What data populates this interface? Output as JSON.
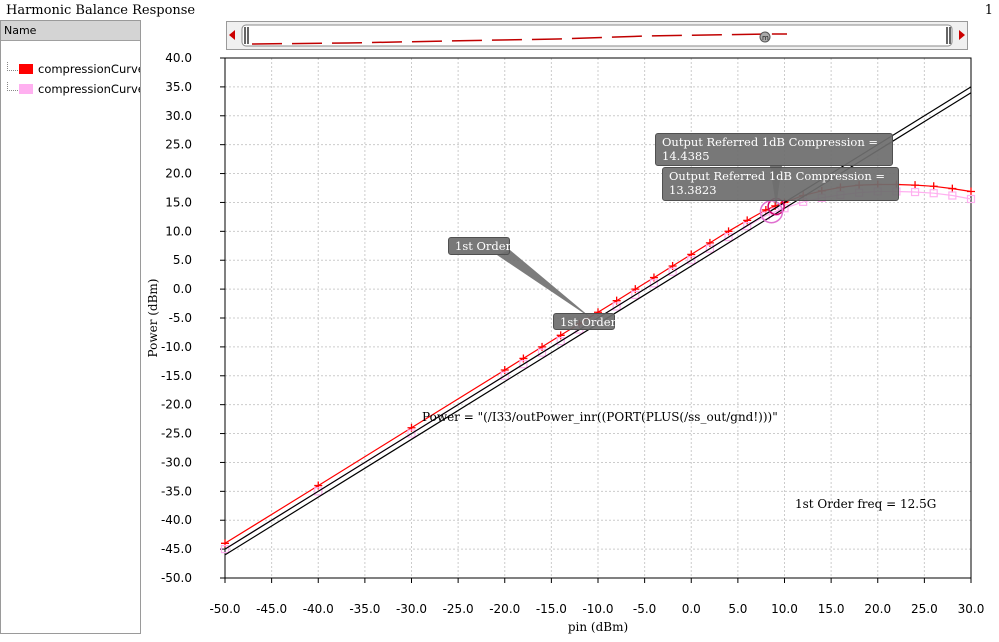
{
  "window": {
    "title": "Harmonic Balance Response",
    "number": "1"
  },
  "legend": {
    "header": "Name",
    "items": [
      {
        "label": "compressionCurve",
        "color": "#ff0000"
      },
      {
        "label": "compressionCurve",
        "color": "#ffb0f0"
      }
    ]
  },
  "colors": {
    "grid": "#cccccc",
    "line_black": "#000000",
    "annotation_bg": "#6e6e6e"
  },
  "annotations": {
    "compression1": "Output Referred 1dB Compression = \n14.4385",
    "compression2": "Output Referred 1dB Compression = \n13.3823",
    "order1_top": "1st Order",
    "order1_bottom": "1st Order",
    "expr1": "Power = \"(/I33/outPower_inr((PORT(PLUS(/ss_out/gnd!)))\"",
    "freq": "1st Order freq = 12.5G"
  },
  "chart_data": {
    "type": "line",
    "xlabel": "pin (dBm)",
    "ylabel": "Power (dBm)",
    "xlim": [
      -50,
      30
    ],
    "ylim": [
      -50,
      40
    ],
    "xticks": [
      "-50.0",
      "-45.0",
      "-40.0",
      "-35.0",
      "-30.0",
      "-25.0",
      "-20.0",
      "-15.0",
      "-10.0",
      "-5.0",
      "0.0",
      "5.0",
      "10.0",
      "15.0",
      "20.0",
      "25.0",
      "30.0"
    ],
    "yticks": [
      "40.0",
      "35.0",
      "30.0",
      "25.0",
      "20.0",
      "15.0",
      "10.0",
      "5.0",
      "0.0",
      "-5.0",
      "-10.0",
      "-15.0",
      "-20.0",
      "-25.0",
      "-30.0",
      "-35.0",
      "-40.0",
      "-45.0",
      "-50.0"
    ],
    "grid": true,
    "series": [
      {
        "name": "compressionCurve",
        "color": "#ff0000",
        "marker": "plus",
        "x": [
          -50,
          -40,
          -30,
          -20,
          -18,
          -16,
          -14,
          -12,
          -10,
          -8,
          -6,
          -4,
          -2,
          0,
          2,
          4,
          6,
          8,
          9,
          10,
          12,
          14,
          16,
          18,
          20,
          22,
          24,
          26,
          28,
          30
        ],
        "y": [
          -44,
          -34,
          -24,
          -14,
          -12,
          -10,
          -8,
          -6,
          -4,
          -2,
          0,
          2,
          4,
          6,
          8,
          10,
          11.9,
          13.7,
          14.4,
          15.0,
          16.2,
          17.0,
          17.6,
          18.0,
          18.1,
          18.1,
          18.0,
          17.8,
          17.4,
          16.9
        ]
      },
      {
        "name": "compressionCurve",
        "color": "#ffb0f0",
        "marker": "square",
        "x": [
          -50,
          -40,
          -30,
          -20,
          -18,
          -16,
          -14,
          -12,
          -10,
          -8,
          -6,
          -4,
          -2,
          0,
          2,
          4,
          6,
          8,
          9,
          10,
          12,
          14,
          16,
          18,
          20,
          22,
          24,
          26,
          28,
          30
        ],
        "y": [
          -45,
          -35,
          -25,
          -15,
          -13,
          -11,
          -9,
          -7,
          -5,
          -3,
          -1,
          1,
          3,
          5,
          7,
          9,
          10.9,
          12.7,
          13.4,
          14.0,
          15.1,
          15.8,
          16.3,
          16.7,
          16.9,
          16.9,
          16.8,
          16.6,
          16.2,
          15.6
        ]
      },
      {
        "name": "1st Order",
        "color": "#000000",
        "marker": "none",
        "x": [
          -50,
          30
        ],
        "y": [
          -45,
          35
        ]
      },
      {
        "name": "1st Order",
        "color": "#000000",
        "marker": "none",
        "x": [
          -50,
          30
        ],
        "y": [
          -46,
          34
        ]
      }
    ]
  }
}
